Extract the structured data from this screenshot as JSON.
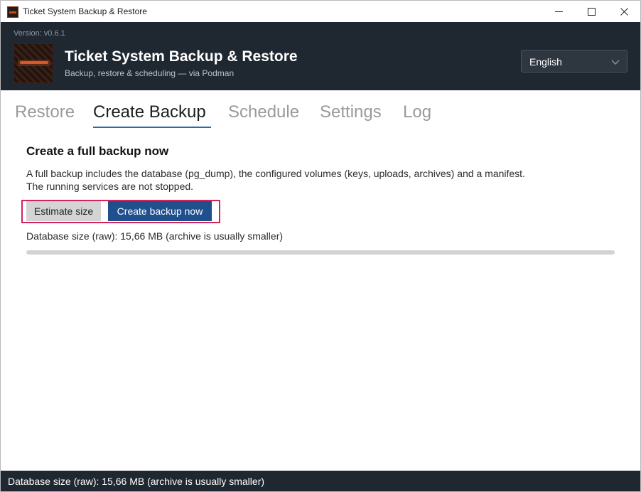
{
  "window": {
    "title": "Ticket System Backup & Restore",
    "icon": "app-logo-icon"
  },
  "header": {
    "version": "Version: v0.6.1",
    "title": "Ticket System Backup & Restore",
    "subtitle": "Backup, restore & scheduling — via Podman",
    "language": {
      "selected": "English",
      "icon": "chevron-down-icon"
    }
  },
  "tabs": [
    {
      "label": "Restore",
      "active": false
    },
    {
      "label": "Create Backup",
      "active": true
    },
    {
      "label": "Schedule",
      "active": false
    },
    {
      "label": "Settings",
      "active": false
    },
    {
      "label": "Log",
      "active": false
    }
  ],
  "backup": {
    "title": "Create a full backup now",
    "description": "A full backup includes the database (pg_dump), the configured volumes (keys, uploads, archives) and a manifest. The running services are not stopped.",
    "estimate_label": "Estimate size",
    "create_label": "Create backup now",
    "size_info": "Database size (raw): 15,66 MB (archive is usually smaller)",
    "progress": 0
  },
  "status": {
    "text": "Database size (raw): 15,66 MB (archive is usually smaller)"
  },
  "colors": {
    "header_bg": "#1f2731",
    "accent": "#1f4f8d",
    "highlight": "#d0245a"
  }
}
